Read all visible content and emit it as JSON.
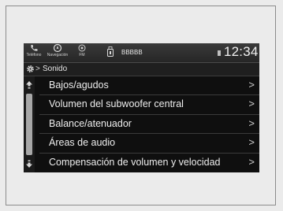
{
  "topbar": {
    "phone_label": "Teléfono",
    "nav_label": "Navegación",
    "fm_label": "FM",
    "source_label": "BBBBB",
    "clock": "12:34"
  },
  "breadcrumb": {
    "separator": ">",
    "title": "Sonido"
  },
  "menu": {
    "items": [
      {
        "label": "Bajos/agudos",
        "chevron": ">"
      },
      {
        "label": "Volumen del subwoofer central",
        "chevron": ">"
      },
      {
        "label": "Balance/atenuador",
        "chevron": ">"
      },
      {
        "label": "Áreas de audio",
        "chevron": ">"
      },
      {
        "label": "Compensación de volumen y velocidad",
        "chevron": ">"
      }
    ]
  },
  "icons": {
    "phone": "phone-icon",
    "navigation": "navigation-icon",
    "fm": "fm-radio-icon",
    "usb": "usb-icon",
    "settings": "gear-icon",
    "scroll_up": "scroll-up-icon",
    "scroll_down": "scroll-down-icon"
  }
}
